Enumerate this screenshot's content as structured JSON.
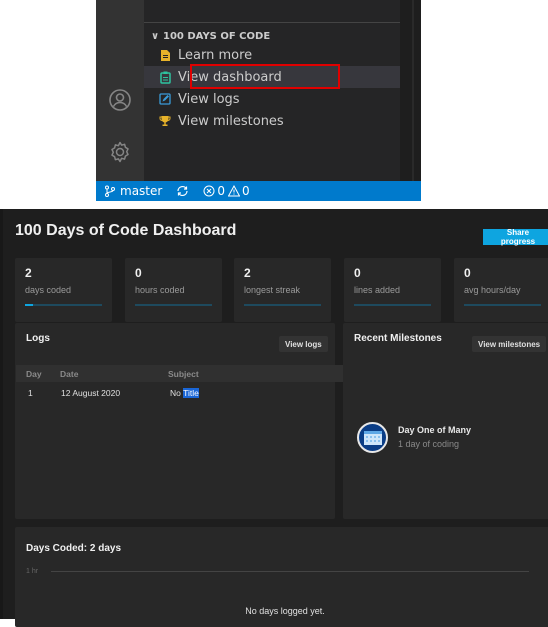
{
  "vscode": {
    "section_title": "100 DAYS OF CODE",
    "items": [
      {
        "label": "Learn more",
        "icon": "document-icon",
        "color": "#e8b32a"
      },
      {
        "label": "View dashboard",
        "icon": "clipboard-icon",
        "color": "#2ec4a0",
        "selected": true
      },
      {
        "label": "View logs",
        "icon": "edit-icon",
        "color": "#3a9bd9"
      },
      {
        "label": "View milestones",
        "icon": "trophy-icon",
        "color": "#e8b32a"
      }
    ],
    "status": {
      "branch": "master",
      "errors": "0",
      "warnings": "0"
    },
    "colors": {
      "status_bar": "#007acc",
      "highlight": "#e00000"
    }
  },
  "dashboard": {
    "title": "100 Days of Code Dashboard",
    "share_label": "Share progress",
    "stats": [
      {
        "value": "2",
        "label": "days coded",
        "progress": 0.02
      },
      {
        "value": "0",
        "label": "hours coded",
        "progress": 0
      },
      {
        "value": "2",
        "label": "longest streak",
        "progress": 0
      },
      {
        "value": "0",
        "label": "lines added",
        "progress": 0
      },
      {
        "value": "0",
        "label": "avg hours/day",
        "progress": 0
      }
    ],
    "logs": {
      "title": "Logs",
      "button": "View logs",
      "columns": [
        "Day",
        "Date",
        "Subject"
      ],
      "rows": [
        {
          "day": "1",
          "date": "12 August 2020",
          "subject_plain": "No",
          "subject_selected": "Title"
        }
      ]
    },
    "milestones": {
      "title": "Recent Milestones",
      "button": "View milestones",
      "items": [
        {
          "title": "Day One of Many",
          "subtitle": "1 day of coding"
        }
      ]
    },
    "days_coded": {
      "title": "Days Coded: 2 days",
      "axis_label": "1 hr",
      "empty_message": "No days logged yet."
    },
    "accent": "#0ea5e0"
  }
}
